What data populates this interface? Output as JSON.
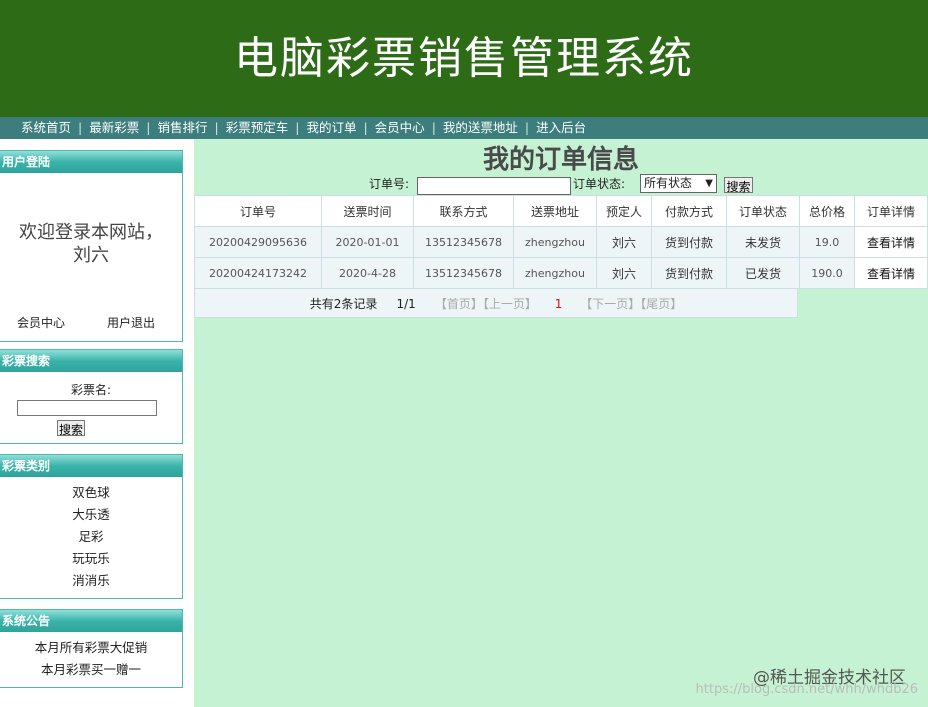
{
  "header": {
    "title": "电脑彩票销售管理系统"
  },
  "nav": {
    "items": [
      "系统首页",
      "最新彩票",
      "销售排行",
      "彩票预定车",
      "我的订单",
      "会员中心",
      "我的送票地址",
      "进入后台"
    ],
    "separator": "|"
  },
  "login_panel": {
    "title": "用户登陆",
    "welcome": "欢迎登录本网站，",
    "username": "刘六",
    "member_center": "会员中心",
    "logout": "用户退出"
  },
  "search_panel": {
    "title": "彩票搜索",
    "label": "彩票名:",
    "input_value": "",
    "button": "搜索"
  },
  "category_panel": {
    "title": "彩票类别",
    "items": [
      "双色球",
      "大乐透",
      "足彩",
      "玩玩乐",
      "消消乐"
    ]
  },
  "notice_panel": {
    "title": "系统公告",
    "items": [
      "本月所有彩票大促销",
      "本月彩票买一赠一"
    ]
  },
  "main": {
    "heading": "我的订单信息",
    "filter": {
      "order_no_label": "订单号:",
      "order_no_value": "",
      "status_label": "订单状态:",
      "status_selected": "所有状态",
      "search_button": "搜索"
    },
    "table": {
      "columns": [
        "订单号",
        "送票时间",
        "联系方式",
        "送票地址",
        "预定人",
        "付款方式",
        "订单状态",
        "总价格",
        "订单详情"
      ],
      "rows": [
        [
          "20200429095636",
          "2020-01-01",
          "13512345678",
          "zhengzhou",
          "刘六",
          "货到付款",
          "未发货",
          "19.0",
          "查看详情"
        ],
        [
          "20200424173242",
          "2020-4-28",
          "13512345678",
          "zhengzhou",
          "刘六",
          "货到付款",
          "已发货",
          "190.0",
          "查看详情"
        ]
      ]
    },
    "pager": {
      "total": "共有2条记录",
      "pages": "1/1",
      "first": "【首页】",
      "prev": "【上一页】",
      "current": "1",
      "next": "【下一页】",
      "last": "【尾页】"
    }
  },
  "watermark": {
    "site": "@稀土掘金技术社区",
    "url": "https://blog.csdn.net/whh/whdb26"
  },
  "colors": {
    "header_bg": "#2e6b16",
    "nav_bg": "#3c7d7d",
    "content_bg": "#c5f2d2",
    "panel_head": "#3bb3aa",
    "pager_current": "#dd1111"
  }
}
